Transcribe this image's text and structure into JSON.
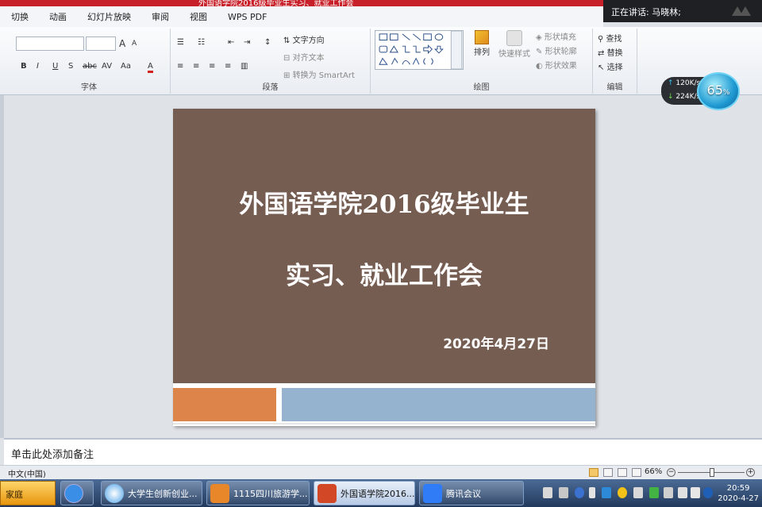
{
  "window": {
    "title_fragment": "外国语学院2016级毕业生实习、就业工作会"
  },
  "meeting": {
    "speaker_text": "正在讲话: 马晓林;"
  },
  "tabs": [
    "切换",
    "动画",
    "幻灯片放映",
    "审阅",
    "视图",
    "WPS PDF"
  ],
  "ribbon": {
    "font_group": {
      "label": "字体",
      "grow": "A",
      "shrink": "A",
      "buttons": [
        "B",
        "I",
        "U",
        "S",
        "abc",
        "AV",
        "Aa",
        "A"
      ]
    },
    "paragraph_group": {
      "label": "段落",
      "text_direction": "文字方向",
      "align_text": "对齐文本",
      "smartart": "转换为 SmartArt"
    },
    "drawing_group": {
      "label": "绘图",
      "arrange": "排列",
      "quick_styles": "快速样式",
      "shape_fill": "形状填充",
      "shape_outline": "形状轮廓",
      "shape_effects": "形状效果"
    },
    "editing_group": {
      "label": "编辑",
      "find": "查找",
      "replace": "替换",
      "select": "选择"
    }
  },
  "speed_widget": {
    "upload": "120",
    "upload_unit": "K/s",
    "download": "224",
    "download_unit": "K/s",
    "percent": "65",
    "percent_unit": "%"
  },
  "slide": {
    "title_line1": "外国语学院2016级毕业生",
    "title_line2": "实习、就业工作会",
    "date": "2020年4月27日",
    "colors": {
      "background": "#765d52",
      "accent_orange": "#dd844a",
      "accent_blue": "#95b3ce"
    }
  },
  "notes": {
    "placeholder": "单击此处添加备注"
  },
  "statusbar": {
    "language": "中文(中国)",
    "zoom": "66%",
    "zoom_minus": "−",
    "zoom_plus": "+",
    "zoom_level": 0.66
  },
  "taskbar": {
    "start_label": "家庭",
    "apps": [
      {
        "label": "大学生创新创业...",
        "icon": "browser-icon"
      },
      {
        "label": "1115四川旅游学...",
        "icon": "pdf-icon"
      },
      {
        "label": "外国语学院2016...",
        "icon": "powerpoint-icon"
      },
      {
        "label": "腾讯会议",
        "icon": "tencent-meeting-icon"
      }
    ],
    "clock_time": "20:59",
    "clock_date": "2020-4-27"
  }
}
